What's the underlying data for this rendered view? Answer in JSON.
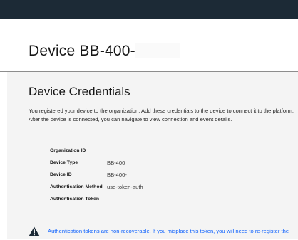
{
  "header": {
    "device_title": "Device BB-400-"
  },
  "credentials": {
    "section_title": "Device Credentials",
    "description_line1": "You registered your device to the organization. Add these credentials to the device to connect it to the platform.",
    "description_line2": "After the device is connected, you can navigate to view connection and event details.",
    "fields": [
      {
        "label": "Organization ID",
        "value": ""
      },
      {
        "label": "Device Type",
        "value": "BB-400"
      },
      {
        "label": "Device ID",
        "value": "BB-400-"
      },
      {
        "label": "Authentication Method",
        "value": "use-token-auth"
      },
      {
        "label": "Authentication Token",
        "value": ""
      }
    ]
  },
  "notice": {
    "icon": "warning-icon",
    "text": "Authentication tokens are non-recoverable. If you misplace this token, you will need to re-register the"
  },
  "colors": {
    "topbar": "#1c2a36",
    "content_bg": "#f4f4f4",
    "notice_text": "#0f62fe",
    "warning_icon": "#1c2a36"
  }
}
